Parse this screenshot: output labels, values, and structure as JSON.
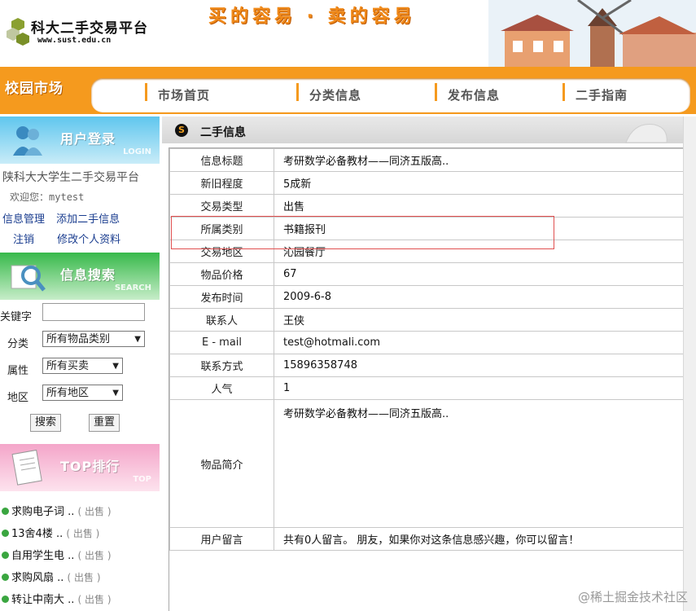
{
  "header": {
    "site_name": "科大二手交易平台",
    "site_url": "www.sust.edu.cn",
    "slogan": "买的容易 · 卖的容易"
  },
  "nav": {
    "brand": "校园市场",
    "items": [
      "市场首页",
      "分类信息",
      "发布信息",
      "二手指南"
    ]
  },
  "sidebar": {
    "login": {
      "title": "用户登录",
      "subtitle": "LOGIN",
      "platform_text": "陕科大大学生二手交易平台",
      "welcome_label": "欢迎您：",
      "username": "mytest",
      "links": [
        "信息管理",
        "添加二手信息",
        "注销",
        "修改个人资料"
      ]
    },
    "search": {
      "title": "信息搜索",
      "subtitle": "SEARCH",
      "keyword_label": "关键字",
      "keyword_value": "",
      "category_label": "分类",
      "category_value": "所有物品类别",
      "property_label": "属性",
      "property_value": "所有买卖",
      "region_label": "地区",
      "region_value": "所有地区",
      "search_button": "搜索",
      "reset_button": "重置"
    },
    "top": {
      "title": "TOP排行",
      "subtitle": "TOP",
      "items": [
        {
          "text": "求购电子词 ..",
          "tag": "( 出售 )"
        },
        {
          "text": "13舍4楼 ..",
          "tag": "( 出售 )"
        },
        {
          "text": "自用学生电 ..",
          "tag": "( 出售 )"
        },
        {
          "text": "求购风扇 ..",
          "tag": "( 出售 )"
        },
        {
          "text": "转让中南大 ..",
          "tag": "( 出售 )"
        }
      ]
    }
  },
  "main": {
    "section_title": "二手信息",
    "icon_letter": "S",
    "rows": [
      {
        "label": "信息标题",
        "value": "考研数学必备教材——同济五版高.."
      },
      {
        "label": "新旧程度",
        "value": "5成新"
      },
      {
        "label": "交易类型",
        "value": "出售"
      },
      {
        "label": "所属类别",
        "value": "书籍报刊"
      },
      {
        "label": "交易地区",
        "value": "沁园餐厅"
      },
      {
        "label": "物品价格",
        "value": "67"
      },
      {
        "label": "发布时间",
        "value": "2009-6-8"
      },
      {
        "label": "联系人",
        "value": "王侠"
      },
      {
        "label": "E - mail",
        "value": "test@hotmali.com"
      },
      {
        "label": "联系方式",
        "value": "15896358748"
      },
      {
        "label": "人气",
        "value": "1"
      }
    ],
    "description": {
      "label": "物品简介",
      "value": "考研数学必备教材——同济五版高.."
    },
    "comment": {
      "label": "用户留言",
      "value": "共有0人留言。 朋友，如果你对这条信息感兴趣，你可以留言！"
    }
  },
  "watermark": "@稀土掘金技术社区",
  "colors": {
    "orange": "#f59a1e",
    "login_blue": "#5fc6ee",
    "search_green": "#37b94a",
    "top_pink": "#f4a5c9",
    "link_blue": "#1a3d8f",
    "highlight_red": "#e05050"
  }
}
